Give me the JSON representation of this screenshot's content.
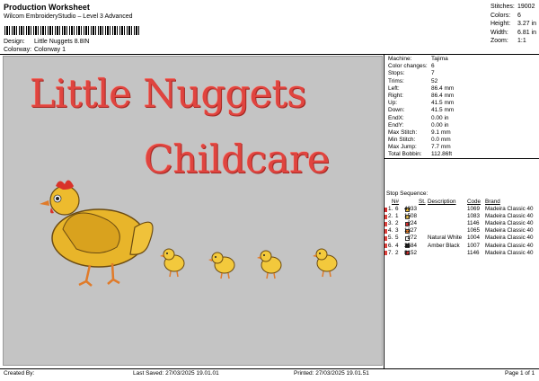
{
  "header": {
    "title": "Production Worksheet",
    "subtitle": "Wilcom EmbroideryStudio – Level 3 Advanced",
    "design_label": "Design:",
    "design_value": "Little Nuggets 8.8IN",
    "colorway_label": "Colorway:",
    "colorway_value": "Colorway 1"
  },
  "stats": [
    {
      "label": "Stitches:",
      "value": "19002"
    },
    {
      "label": "Colors:",
      "value": "6"
    },
    {
      "label": "Height:",
      "value": "3.27 in"
    },
    {
      "label": "Width:",
      "value": "6.81 in"
    },
    {
      "label": "Zoom:",
      "value": "1:1"
    }
  ],
  "design_text": {
    "line1": "Little Nuggets",
    "line2": "Childcare"
  },
  "machine_info": [
    {
      "label": "Machine:",
      "value": "Tajima"
    },
    {
      "label": "Color changes:",
      "value": "6"
    },
    {
      "label": "Stops:",
      "value": "7"
    },
    {
      "label": "Trims:",
      "value": "52"
    },
    {
      "label": "Left:",
      "value": "86.4 mm"
    },
    {
      "label": "Right:",
      "value": "86.4 mm"
    },
    {
      "label": "Up:",
      "value": "41.5 mm"
    },
    {
      "label": "Down:",
      "value": "41.5 mm"
    },
    {
      "label": "EndX:",
      "value": "0.00 in"
    },
    {
      "label": "EndY:",
      "value": "0.00 in"
    },
    {
      "label": "Max Stitch:",
      "value": "9.1 mm"
    },
    {
      "label": "Min Stitch:",
      "value": "0.0 mm"
    },
    {
      "label": "Max Jump:",
      "value": "7.7 mm"
    },
    {
      "label": "Total Bobbin:",
      "value": "112.86ft"
    }
  ],
  "stop_sequence": {
    "title": "Stop Sequence:",
    "headers": {
      "n": "N#",
      "st": "St.",
      "desc": "Description",
      "code": "Code",
      "brand": "Brand"
    },
    "rows": [
      {
        "stop": "1.",
        "n": "6",
        "color": "#f2c037",
        "st": "4933",
        "desc": "",
        "code": "1069",
        "brand": "Madeira Classic 40"
      },
      {
        "stop": "2.",
        "n": "1",
        "color": "#f5c94e",
        "st": "1508",
        "desc": "",
        "code": "1083",
        "brand": "Madeira Classic 40"
      },
      {
        "stop": "3.",
        "n": "2",
        "color": "#d32f2f",
        "st": "224",
        "desc": "",
        "code": "1146",
        "brand": "Madeira Classic 40"
      },
      {
        "stop": "4.",
        "n": "3",
        "color": "#e07b2a",
        "st": "1327",
        "desc": "",
        "code": "1065",
        "brand": "Madeira Classic 40"
      },
      {
        "stop": "5.",
        "n": "5",
        "color": "#f8f8f8",
        "st": "272",
        "desc": "Natural White",
        "code": "1004",
        "brand": "Madeira Classic 40"
      },
      {
        "stop": "6.",
        "n": "4",
        "color": "#222222",
        "st": "2584",
        "desc": "Amber Black",
        "code": "1007",
        "brand": "Madeira Classic 40"
      },
      {
        "stop": "7.",
        "n": "2",
        "color": "#d32f2f",
        "st": "8152",
        "desc": "",
        "code": "1146",
        "brand": "Madeira Classic 40"
      }
    ],
    "row_markers": [
      "#d32f2f",
      "#e0443f",
      "#e0443f",
      "#e0443f",
      "#e0443f",
      "#e0443f",
      "#e0443f"
    ]
  },
  "footer": {
    "created_by": "Created By:",
    "last_saved": "Last Saved: 27/03/2025 19.01.01",
    "printed": "Printed: 27/03/2025 19.01.51",
    "page": "Page 1 of 1"
  }
}
